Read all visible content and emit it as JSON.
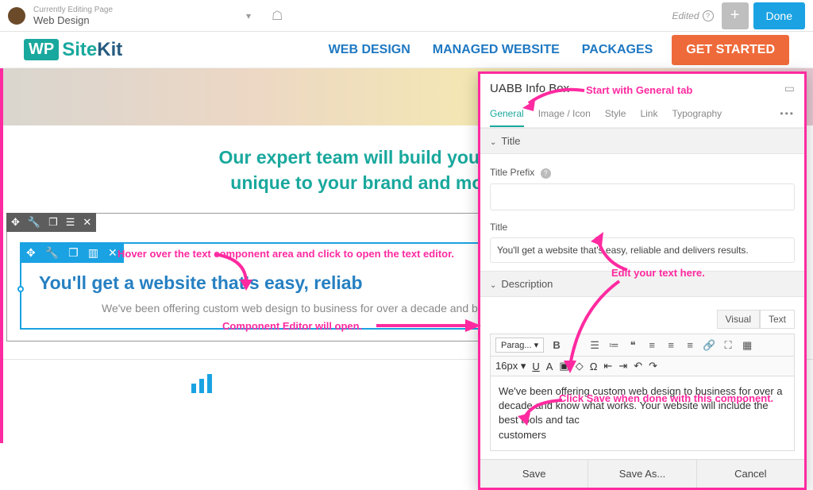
{
  "topbar": {
    "editing_label": "Currently Editing Page",
    "page_name": "Web Design",
    "edited_label": "Edited",
    "done_label": "Done"
  },
  "nav": {
    "items": [
      "WEB DESIGN",
      "MANAGED WEBSITE",
      "PACKAGES"
    ],
    "cta": "GET STARTED",
    "logo_site": "Site",
    "logo_kit": "Kit",
    "logo_wp": "WP"
  },
  "headline": {
    "line1": "Our expert team will build you a custom we",
    "line2": "unique to your brand and motivates visit"
  },
  "module": {
    "title": "You'll get a website that's easy, reliab",
    "body": "We've been offering custom web design to business for over a decade and\nbest tools and tactics that have proven to genera"
  },
  "panel": {
    "title": "UABB Info Box",
    "tabs": [
      "General",
      "Image / Icon",
      "Style",
      "Link",
      "Typography"
    ],
    "sections": {
      "title_head": "Title",
      "prefix_label": "Title Prefix",
      "title_field_label": "Title",
      "title_value": "You'll get a website that's easy, reliable and delivers results.",
      "desc_head": "Description",
      "visual": "Visual",
      "text": "Text",
      "format_select": "Parag...",
      "size_select": "16px",
      "editor_body": "We've been offering custom web design to business for over a decade and know what works. Your website will include the best tools and tac",
      "editor_body_tail": "customers"
    },
    "footer": {
      "save": "Save",
      "save_as": "Save As...",
      "cancel": "Cancel"
    }
  },
  "annotations": {
    "start_general": "Start with General tab",
    "hover_text": "Hover over the text component area and click to open the text editor.",
    "editor_open": "Component Editor will open.",
    "edit_text": "Edit your text here.",
    "click_save": "Click Save when done with this component."
  }
}
